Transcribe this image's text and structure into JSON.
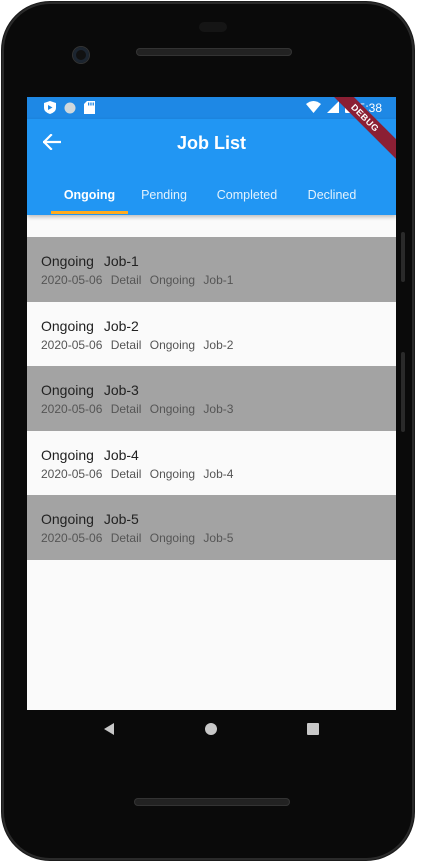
{
  "status_bar": {
    "time": "5:38",
    "icons": [
      "shield-icon",
      "circle-icon",
      "sd-card-icon",
      "wifi-icon",
      "signal-icon",
      "battery-icon"
    ],
    "debug_banner": "DEBUG"
  },
  "app_bar": {
    "title": "Job List",
    "back_icon": "arrow-back-icon",
    "color": "#2196f3"
  },
  "tabs": [
    {
      "label": "Ongoing",
      "active": true
    },
    {
      "label": "Pending",
      "active": false
    },
    {
      "label": "Completed",
      "active": false
    },
    {
      "label": "Declined",
      "active": false
    }
  ],
  "tab_indicator_color": "#ffab1e",
  "jobs": [
    {
      "title": "Ongoing Job-1",
      "subtitle": "2020-05-06 Detail Ongoing Job-1"
    },
    {
      "title": "Ongoing Job-2",
      "subtitle": "2020-05-06 Detail Ongoing Job-2"
    },
    {
      "title": "Ongoing Job-3",
      "subtitle": "2020-05-06 Detail Ongoing Job-3"
    },
    {
      "title": "Ongoing Job-4",
      "subtitle": "2020-05-06 Detail Ongoing Job-4"
    },
    {
      "title": "Ongoing Job-5",
      "subtitle": "2020-05-06 Detail Ongoing Job-5"
    }
  ],
  "nav_bar": {
    "icons": [
      "back-triangle-icon",
      "home-circle-icon",
      "recents-square-icon"
    ]
  }
}
